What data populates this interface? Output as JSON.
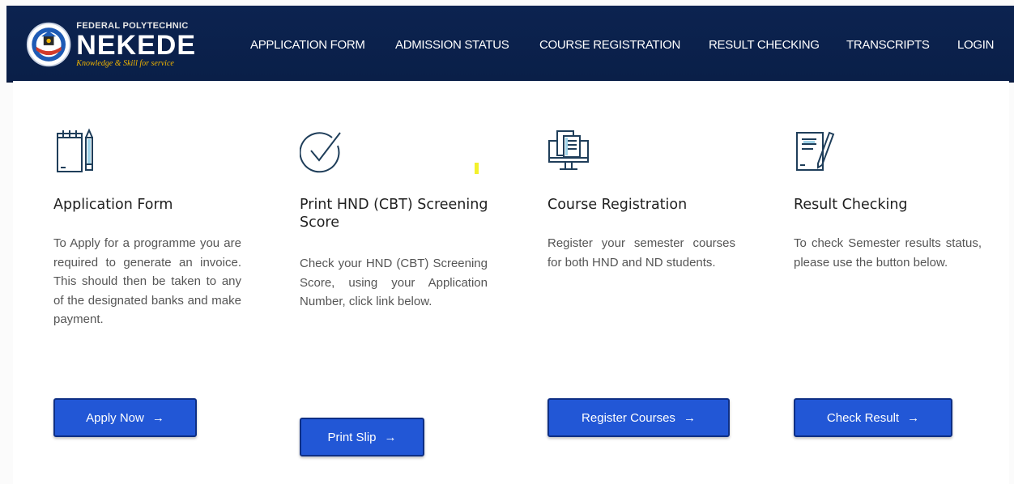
{
  "header": {
    "logo_top": "FEDERAL POLYTECHNIC",
    "logo_main": "NEKEDE",
    "logo_sub": "Knowledge & Skill for service",
    "nav": [
      {
        "label": "APPLICATION FORM"
      },
      {
        "label": "ADMISSION STATUS"
      },
      {
        "label": "COURSE REGISTRATION"
      },
      {
        "label": "RESULT CHECKING"
      },
      {
        "label": "TRANSCRIPTS"
      },
      {
        "label": "LOGIN"
      }
    ]
  },
  "cards": [
    {
      "icon": "notepad-pencil-icon",
      "title": "Application Form",
      "body": "To Apply for a programme you are required to generate an invoice. This should then be taken to any of the designated banks and make payment.",
      "button": "Apply Now"
    },
    {
      "icon": "checkmark-circle-icon",
      "title": "Print HND (CBT) Screening Score",
      "body": "Check your HND (CBT) Screening Score, using your Application Number, click link below.",
      "button": "Print Slip"
    },
    {
      "icon": "computer-monitor-icon",
      "title": "Course Registration",
      "body": "Register your semester courses for both HND and ND students.",
      "button": "Register Courses"
    },
    {
      "icon": "document-pen-icon",
      "title": "Result Checking",
      "body": "To check Semester results status, please use the button below.",
      "button": "Check Result"
    }
  ],
  "colors": {
    "navbar": "#0c2350",
    "button": "#2257d6",
    "button_border": "#0e2f85",
    "icon_stroke": "#1f3e5a",
    "accent_yellow": "#f0b400"
  }
}
